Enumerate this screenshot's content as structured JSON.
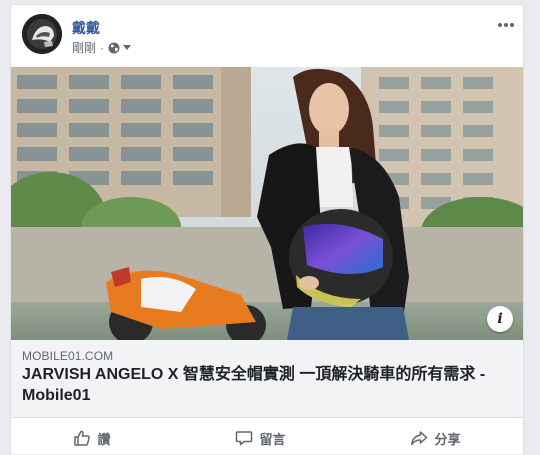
{
  "post": {
    "author": "戴戴",
    "time": "剛剛",
    "separator": "·",
    "privacy_icon": "globe-icon",
    "menu_icon": "more-options-icon"
  },
  "link_preview": {
    "domain": "MOBILE01.COM",
    "title": "JARVISH ANGELO X 智慧安全帽實測 一頂解決騎車的所有需求 - Mobile01",
    "info_label": "i",
    "image_subject": "woman in black leather jacket holding a helmet with a purple visor in front of apartment buildings and a motorcycle"
  },
  "actions": [
    {
      "label": "讚",
      "icon": "like-icon"
    },
    {
      "label": "留言",
      "icon": "comment-icon"
    },
    {
      "label": "分享",
      "icon": "share-icon"
    }
  ],
  "colors": {
    "author": "#365899",
    "secondary_text": "#606770",
    "link_box_bg": "#f2f3f5",
    "page_bg": "#e9ebee"
  }
}
